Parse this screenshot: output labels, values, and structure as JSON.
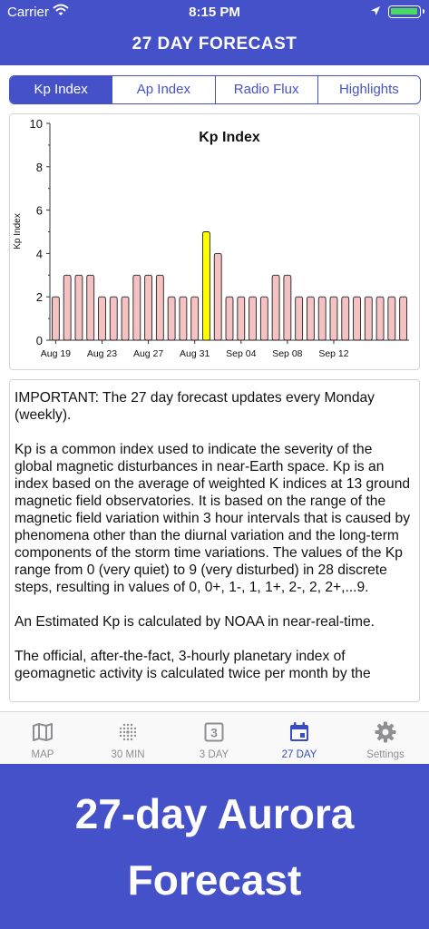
{
  "status_bar": {
    "carrier": "Carrier",
    "time": "8:15 PM"
  },
  "nav": {
    "title": "27 DAY FORECAST"
  },
  "segments": [
    {
      "label": "Kp Index",
      "active": true
    },
    {
      "label": "Ap Index",
      "active": false
    },
    {
      "label": "Radio Flux",
      "active": false
    },
    {
      "label": "Highlights",
      "active": false
    }
  ],
  "chart_data": {
    "type": "bar",
    "title": "Kp Index",
    "xlabel": "",
    "ylabel": "Kp Index",
    "ylim": [
      0,
      10
    ],
    "yticks": [
      0,
      2,
      4,
      6,
      8,
      10
    ],
    "x_tick_labels": [
      "Aug 19",
      "Aug 23",
      "Aug 27",
      "Aug 31",
      "Sep 04",
      "Sep 08",
      "Sep 12"
    ],
    "categories": [
      "Aug 19",
      "Aug 20",
      "Aug 21",
      "Aug 22",
      "Aug 23",
      "Aug 24",
      "Aug 25",
      "Aug 26",
      "Aug 27",
      "Aug 28",
      "Aug 29",
      "Aug 30",
      "Aug 31",
      "Sep 01",
      "Sep 02",
      "Sep 03",
      "Sep 04",
      "Sep 05",
      "Sep 06",
      "Sep 07",
      "Sep 08",
      "Sep 09",
      "Sep 10",
      "Sep 11",
      "Sep 12",
      "Sep 13",
      "Sep 14",
      "Sep 15",
      "Sep 16",
      "Sep 17",
      "Sep 18"
    ],
    "values": [
      2,
      3,
      3,
      3,
      2,
      2,
      2,
      3,
      3,
      3,
      2,
      2,
      2,
      5,
      4,
      2,
      2,
      2,
      2,
      3,
      3,
      2,
      2,
      2,
      2,
      2,
      2,
      2,
      2,
      2,
      2
    ],
    "highlight_index": 13,
    "bar_color": "#f4c2c2",
    "highlight_color": "#ffff00",
    "grid": false
  },
  "info": {
    "paragraphs": [
      "IMPORTANT: The 27 day forecast updates every Monday (weekly).",
      "Kp is a common index used to indicate the severity of the global magnetic disturbances in near-Earth space. Kp is an index based on the average of weighted K indices at 13 ground magnetic field observatories. It is based on the range of the magnetic field variation within 3 hour intervals that is caused by phenomena other than the diurnal variation and the long-term components of the storm time variations. The values of the Kp range from 0 (very quiet) to 9 (very disturbed) in 28 discrete steps, resulting in values of 0, 0+, 1-, 1, 1+, 2-, 2, 2+,...9.",
      "An Estimated Kp is calculated by NOAA in near-real-time.",
      "The official, after-the-fact, 3-hourly planetary index of geomagnetic activity is calculated twice per month by the"
    ]
  },
  "tabs": [
    {
      "label": "MAP",
      "icon": "map-icon"
    },
    {
      "label": "30 MIN",
      "icon": "dot-grid-icon"
    },
    {
      "label": "3 DAY",
      "icon": "three-day-calendar-icon"
    },
    {
      "label": "27 DAY",
      "icon": "calendar-icon",
      "active": true
    },
    {
      "label": "Settings",
      "icon": "gear-icon"
    }
  ],
  "promo": {
    "line1": "27-day Aurora",
    "line2": "Forecast"
  },
  "colors": {
    "primary": "#4551c9",
    "tab_active": "#3a4bc4",
    "tab_inactive": "#8e8e93"
  }
}
